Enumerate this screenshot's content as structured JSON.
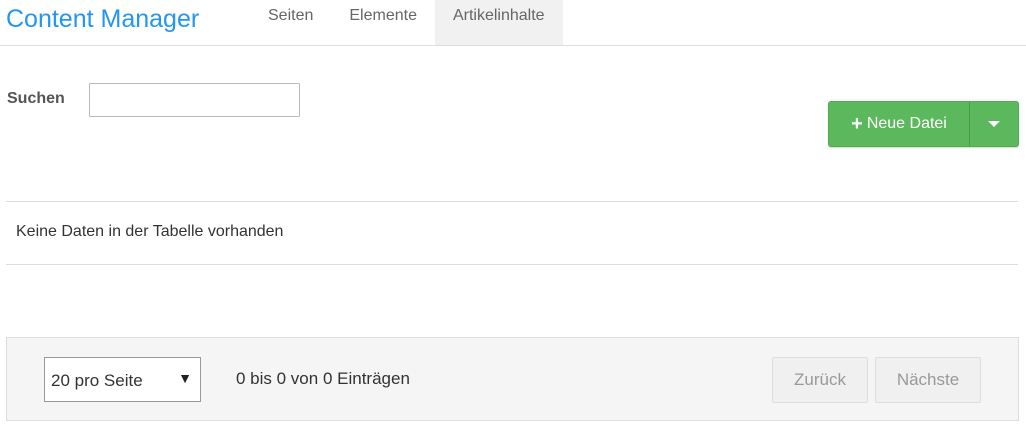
{
  "header": {
    "app_title": "Content Manager",
    "tabs": [
      {
        "label": "Seiten",
        "active": false
      },
      {
        "label": "Elemente",
        "active": false
      },
      {
        "label": "Artikelinhalte",
        "active": true
      }
    ]
  },
  "search": {
    "label": "Suchen",
    "value": "",
    "placeholder": ""
  },
  "actions": {
    "new_file_label": "Neue Datei",
    "new_file_icon": "plus-icon",
    "dropdown_icon": "caret-down-icon",
    "accent_color": "#5cb85c"
  },
  "table": {
    "empty_message": "Keine Daten in der Tabelle vorhanden"
  },
  "pagination": {
    "page_size_selected": "20 pro Seite",
    "info": "0 bis 0 von 0 Einträgen",
    "prev_label": "Zurück",
    "next_label": "Nächste"
  },
  "colors": {
    "brand": "#2196f3",
    "success": "#5cb85c"
  }
}
